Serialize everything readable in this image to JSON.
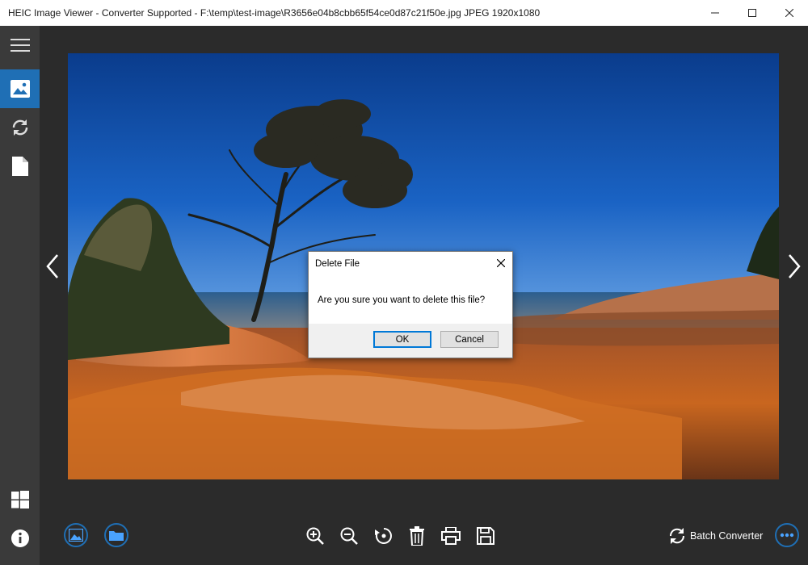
{
  "window": {
    "title": "HEIC Image Viewer - Converter Supported - F:\\temp\\test-image\\R3656e04b8cbb65f54ce0d87c21f50e.jpg JPEG 1920x1080"
  },
  "sidebar": {
    "items": [
      {
        "icon": "hamburger-menu-icon"
      },
      {
        "icon": "image-icon",
        "active": true
      },
      {
        "icon": "refresh-icon"
      },
      {
        "icon": "document-icon"
      },
      {
        "icon": "windows-logo-icon"
      },
      {
        "icon": "info-icon"
      }
    ]
  },
  "dialog": {
    "title": "Delete File",
    "message": "Are you sure you want to delete this file?",
    "ok_label": "OK",
    "cancel_label": "Cancel"
  },
  "toolbar": {
    "batch_label": "Batch Converter",
    "tools": [
      "zoom-in-icon",
      "zoom-out-icon",
      "rotate-icon",
      "trash-icon",
      "print-icon",
      "save-icon"
    ]
  },
  "colors": {
    "accent": "#1f6fb5",
    "sidebar_bg": "#3a3a3a",
    "main_bg": "#2b2b2b"
  }
}
